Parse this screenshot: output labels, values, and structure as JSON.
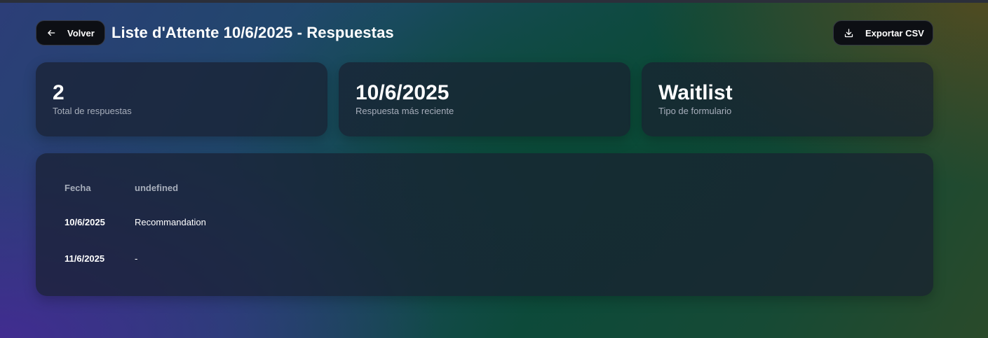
{
  "header": {
    "back_label": "Volver",
    "title": "Liste d'Attente 10/6/2025 - Respuestas",
    "export_label": "Exportar CSV"
  },
  "stats": [
    {
      "value": "2",
      "label": "Total de respuestas"
    },
    {
      "value": "10/6/2025",
      "label": "Respuesta más reciente"
    },
    {
      "value": "Waitlist",
      "label": "Tipo de formulario"
    }
  ],
  "table": {
    "columns": [
      "Fecha",
      "undefined"
    ],
    "rows": [
      [
        "10/6/2025",
        "Recommandation"
      ],
      [
        "11/6/2025",
        "-"
      ]
    ]
  },
  "icons": {
    "back": "arrow-left-icon",
    "export": "download-icon"
  }
}
